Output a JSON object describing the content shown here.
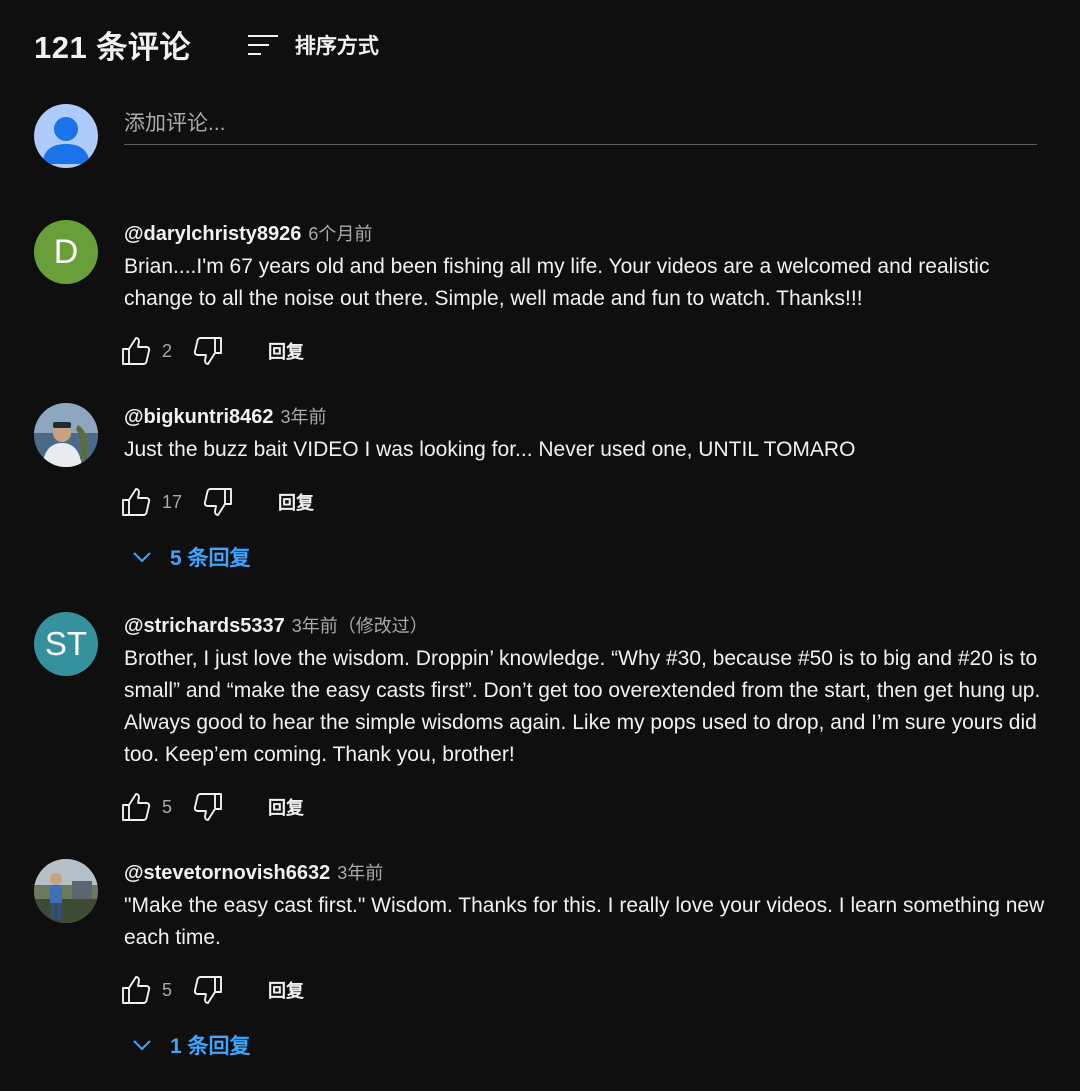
{
  "header": {
    "comment_count": "121 条评论",
    "sort_label": "排序方式",
    "sort_icon": "sort-icon"
  },
  "add_comment": {
    "placeholder": "添加评论...",
    "avatar_icon": "person-icon",
    "avatar_color": "#aecbfa"
  },
  "comments": [
    {
      "author": "@darylchristy8926",
      "time": "6个月前",
      "edited": "",
      "avatar_letter": "D",
      "avatar_color": "#689f38",
      "text": "Brian....I'm 67 years old and been fishing all my life. Your videos are a welcomed and realistic change to all the noise out there. Simple, well made and fun to watch. Thanks!!!",
      "likes": "2",
      "reply_label": "回复",
      "replies_label": ""
    },
    {
      "author": "@bigkuntri8462",
      "time": "3年前",
      "edited": "",
      "avatar_letter": "",
      "avatar_color": "#3b4a5e",
      "text": "Just the buzz bait VIDEO I was looking for... Never used one, UNTIL TOMARO",
      "likes": "17",
      "reply_label": "回复",
      "replies_label": "5 条回复"
    },
    {
      "author": "@strichards5337",
      "time": "3年前",
      "edited": "（修改过）",
      "avatar_letter": "ST",
      "avatar_color": "#36919f",
      "text": "Brother, I just love the wisdom. Droppin’ knowledge.  “Why #30, because #50 is to big and #20 is to small” and “make the easy casts first”.  Don’t get too overextended from the start, then get hung up.  Always good to hear the simple wisdoms again. Like my pops used to drop, and I’m sure yours did too.  Keep’em coming.  Thank you, brother!",
      "likes": "5",
      "reply_label": "回复",
      "replies_label": ""
    },
    {
      "author": "@stevetornovish6632",
      "time": "3年前",
      "edited": "",
      "avatar_letter": "",
      "avatar_color": "#4e5a4a",
      "text": "\"Make the easy cast first.\"  Wisdom.  Thanks for this.  I really love your videos.  I learn something new each time.",
      "likes": "5",
      "reply_label": "回复",
      "replies_label": "1 条回复"
    }
  ],
  "colors": {
    "background": "#0f0f0f",
    "text": "#f1f1f1",
    "secondary_text": "#aaaaaa",
    "link_blue": "#3ea6ff"
  }
}
